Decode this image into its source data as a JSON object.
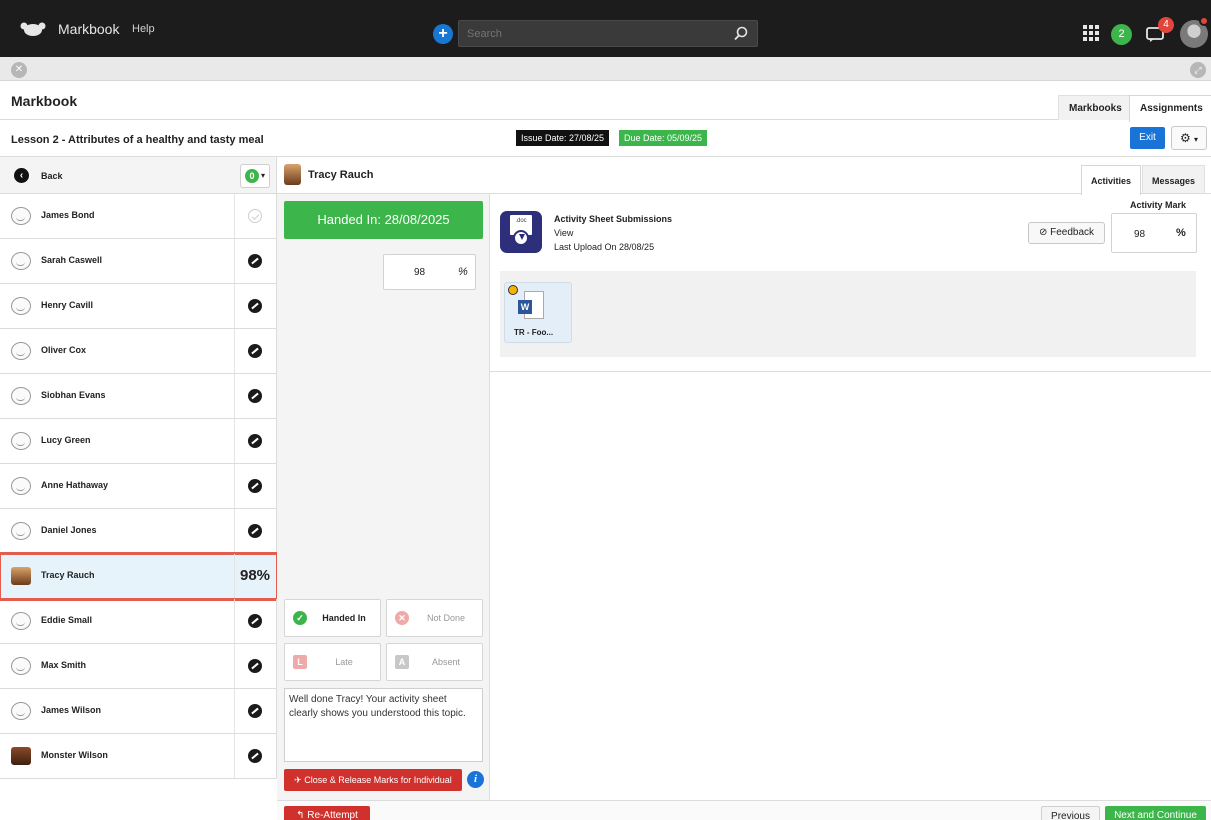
{
  "topbar": {
    "app_title": "Markbook",
    "help": "Help",
    "search_placeholder": "Search",
    "notifications_count": "2",
    "messages_count": "4"
  },
  "header": {
    "title": "Markbook",
    "tabs": [
      "Markbooks",
      "Assignments"
    ]
  },
  "lesson": {
    "title": "Lesson 2 - Attributes of a healthy and tasty meal",
    "issue_date": "Issue Date: 27/08/25",
    "due_date": "Due Date: 05/09/25",
    "exit_label": "Exit"
  },
  "left_panel": {
    "back_label": "Back",
    "count": "0",
    "students": [
      {
        "name": "James Bond",
        "status": "handed"
      },
      {
        "name": "Sarah Caswell",
        "status": "hidden"
      },
      {
        "name": "Henry Cavill",
        "status": "hidden"
      },
      {
        "name": "Oliver Cox",
        "status": "hidden"
      },
      {
        "name": "Siobhan Evans",
        "status": "hidden"
      },
      {
        "name": "Lucy Green",
        "status": "hidden"
      },
      {
        "name": "Anne Hathaway",
        "status": "hidden"
      },
      {
        "name": "Daniel Jones",
        "status": "hidden"
      },
      {
        "name": "Tracy Rauch",
        "score": "98%",
        "selected": true
      },
      {
        "name": "Eddie Small",
        "status": "hidden"
      },
      {
        "name": "Max Smith",
        "status": "hidden"
      },
      {
        "name": "James Wilson",
        "status": "hidden"
      },
      {
        "name": "Monster Wilson",
        "status": "hidden"
      }
    ]
  },
  "student_detail": {
    "name": "Tracy Rauch",
    "handed_in": "Handed In: 28/08/2025",
    "mark_value": "98",
    "mark_unit": "%",
    "states": [
      "Handed In",
      "Not Done",
      "Late",
      "Absent"
    ],
    "comment": "Well done Tracy!  Your activity sheet clearly shows you understood this topic.",
    "release_label": "Close & Release Marks for Individual",
    "reattempt_label": "Re-Attempt"
  },
  "activities": {
    "tabs": [
      "Activities",
      "Messages"
    ],
    "title": "Activity Sheet Submissions",
    "view": "View",
    "last_upload": "Last Upload On 28/08/25",
    "mark_label": "Activity Mark",
    "feedback_label": "Feedback",
    "mark_value": "98",
    "mark_unit": "%",
    "file_name": "TR - Foo...",
    "doc_ext": ".doc"
  },
  "footer": {
    "previous": "Previous",
    "next": "Next and Continue"
  },
  "colors": {
    "accent_blue": "#1a73d6",
    "green": "#3cb54a",
    "red": "#d0312d",
    "highlight": "#e35c4c"
  }
}
